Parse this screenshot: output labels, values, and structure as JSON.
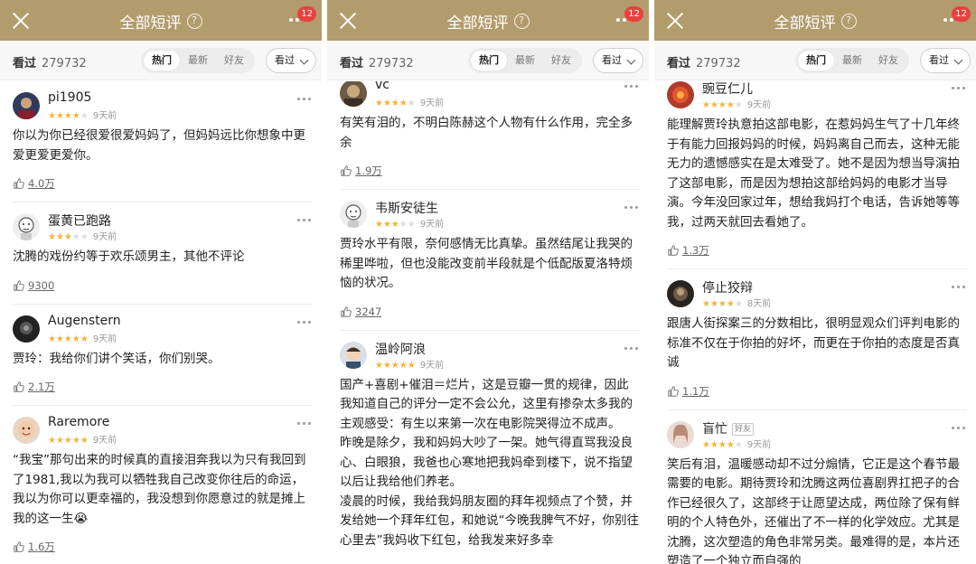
{
  "header": {
    "title": "全部短评",
    "help_glyph": "?",
    "badge": "12"
  },
  "filter": {
    "seen_label": "看过",
    "seen_count": "279732",
    "tabs": [
      "热门",
      "最新",
      "好友"
    ],
    "active_tab": "热门",
    "dropdown_label": "看过"
  },
  "colors": {
    "header_bg": "#b39c6c",
    "badge": "#e8413e",
    "star": "#f0b43a"
  },
  "screens": [
    {
      "comments": [
        {
          "user": "pi1905",
          "avatar": "avatar-dark-blue",
          "stars": 4,
          "time": "9天前",
          "text": "你以为你已经很爱很爱妈妈了，但妈妈远比你想象中更爱更爱更爱你。",
          "votes": "4.0万"
        },
        {
          "user": "蛋黄已跑路",
          "avatar": "avatar-sketch",
          "stars": 3,
          "time": "9天前",
          "text": "沈腾的戏份约等于欢乐颂男主，其他不评论",
          "votes": "9300"
        },
        {
          "user": "Augenstern",
          "avatar": "avatar-dark",
          "stars": 5,
          "time": "9天前",
          "text": "贾玲：我给你们讲个笑话，你们别哭。",
          "votes": "2.1万"
        },
        {
          "user": "Raremore",
          "avatar": "avatar-face",
          "stars": 5,
          "time": "9天前",
          "text": "“我宝”那句出来的时候真的直接泪奔我以为只有我回到了1981,我以为我可以牺牲我自己改变你往后的命运，我以为你可以更幸福的，我没想到你愿意过的就是摊上我的这一生😭",
          "votes": "1.6万"
        }
      ]
    },
    {
      "comments": [
        {
          "user": "vc",
          "avatar": "avatar-brown",
          "stars": 4,
          "time": "9天前",
          "text": "有笑有泪的，不明白陈赫这个人物有什么作用，完全多余",
          "votes": "1.9万"
        },
        {
          "user": "韦斯安徒生",
          "avatar": "avatar-sketch",
          "stars": 3,
          "time": "9天前",
          "text": "贾玲水平有限，奈何感情无比真挚。虽然结尾让我哭的稀里哗啦，但也没能改变前半段就是个低配版夏洛特烦恼的状况。",
          "votes": "3247"
        },
        {
          "user": "温岭阿浪",
          "avatar": "avatar-face2",
          "stars": 5,
          "time": "9天前",
          "paragraphs": [
            "国产+喜剧+催泪＝烂片，这是豆瓣一贯的规律，因此我知道自己的评分一定不会公允，这里有掺杂太多我的主观感受：有生以来第一次在电影院哭得泣不成声。",
            "昨晚是除夕，我和妈妈大吵了一架。她气得直骂我没良心、白眼狼，我爸也心寒地把我妈牵到楼下，说不指望以后让我给他们养老。",
            "凌晨的时候，我给我妈朋友圈的拜年视频点了个赞，并发给她一个拜年红包，和她说“今晚我脾气不好，你别往心里去”我妈收下红包，给我发来好多幸"
          ],
          "votes": ""
        }
      ]
    },
    {
      "comments": [
        {
          "user": "豌豆仁儿",
          "avatar": "avatar-red",
          "stars": 4,
          "time": "9天前",
          "text": "能理解贾玲执意拍这部电影，在惹妈妈生气了十几年终于有能力回报妈妈的时候，妈妈离自己而去，这种无能无力的遗憾感实在是太难受了。她不是因为想当导演拍了这部电影，而是因为想拍这部给妈妈的电影才当导演。今年没回家过年，想给我妈打个电话，告诉她等等我，过两天就回去看她了。",
          "votes": "1.3万"
        },
        {
          "user": "停止狡辩",
          "avatar": "avatar-dark2",
          "stars": 4,
          "time": "8天前",
          "text": "跟唐人街探案三的分数相比，很明显观众们评判电影的标准不仅在于你拍的好坏，而更在于你拍的态度是否真诚",
          "votes": "1.1万"
        },
        {
          "user": "盲忙",
          "tag": "好友",
          "avatar": "avatar-girl",
          "stars": 4,
          "time": "9天前",
          "text": "笑后有泪，温暖感动却不过分煽情，它正是这个春节最需要的电影。期待贾玲和沈腾这两位喜剧界扛把子的合作已经很久了，这部终于让愿望达成，两位除了保有鲜明的个人特色外，还催出了不一样的化学效应。尤其是沈腾，这次塑造的角色非常另类。最难得的是，本片还塑造了一个独立而自强的",
          "votes": ""
        }
      ]
    }
  ]
}
